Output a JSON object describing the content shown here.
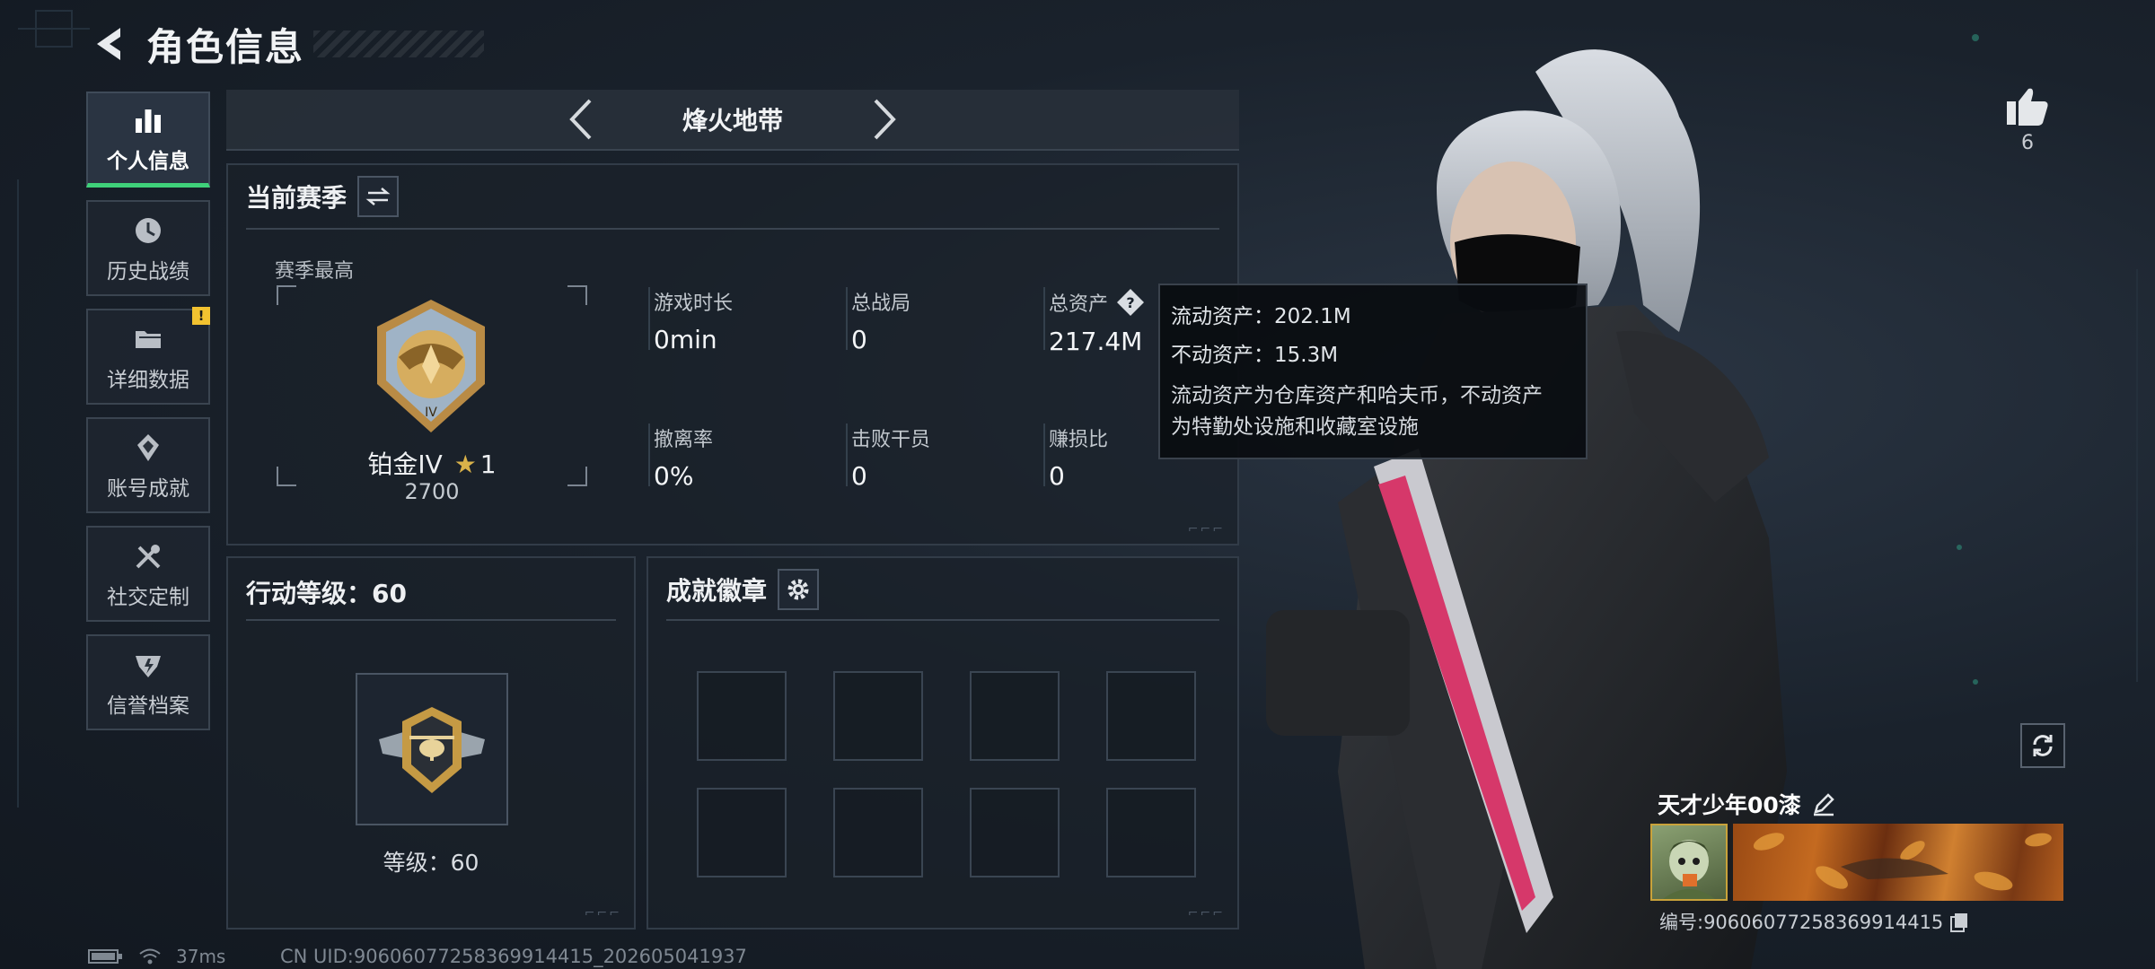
{
  "header": {
    "title": "角色信息"
  },
  "nav": {
    "items": [
      {
        "label": "个人信息",
        "icon": "bar-chart-icon",
        "active": true
      },
      {
        "label": "历史战绩",
        "icon": "clock-icon"
      },
      {
        "label": "详细数据",
        "icon": "folder-icon",
        "badge": "!"
      },
      {
        "label": "账号成就",
        "icon": "achievement-icon"
      },
      {
        "label": "社交定制",
        "icon": "tools-icon"
      },
      {
        "label": "信誉档案",
        "icon": "credit-icon"
      }
    ]
  },
  "mode": {
    "title": "烽火地带"
  },
  "season": {
    "title": "当前赛季",
    "best_label": "赛季最高",
    "rank_name": "铂金IV",
    "rank_stars": "1",
    "rank_score": "2700",
    "stats": [
      {
        "label": "游戏时长",
        "value": "0min"
      },
      {
        "label": "总战局",
        "value": "0"
      },
      {
        "label": "总资产",
        "value": "217.4M"
      },
      {
        "label": "撤离率",
        "value": "0%"
      },
      {
        "label": "击败干员",
        "value": "0"
      },
      {
        "label": "赚损比",
        "value": "0"
      }
    ]
  },
  "tooltip": {
    "liquid": "流动资产：202.1M",
    "fixed": "不动资产：15.3M",
    "desc_line1": "流动资产为仓库资产和哈夫币，不动资产",
    "desc_line2": "为特勤处设施和收藏室设施"
  },
  "action_level": {
    "title": "行动等级：60",
    "level_text": "等级：60"
  },
  "achievements": {
    "title": "成就徽章"
  },
  "profile": {
    "likes": "6",
    "name": "天才少年00漆",
    "id": "编号:9060607725836991441​5"
  },
  "status_bar": {
    "ping": "37ms",
    "uid": "CN UID:9060607725836991441​5_202605041937"
  },
  "colors": {
    "accent_green": "#3fd17a",
    "badge_yellow": "#f2c230",
    "gold": "#c9a23a"
  }
}
